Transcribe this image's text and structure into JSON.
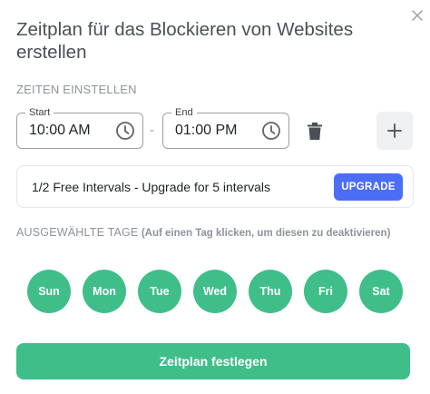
{
  "dialog": {
    "title": "Zeitplan für das Blockieren von Websites erstellen",
    "close_icon": "close-icon"
  },
  "times": {
    "section_label": "ZEITEN EINSTELLEN",
    "start": {
      "label": "Start",
      "value": "10:00 AM",
      "icon": "clock-icon"
    },
    "separator": "-",
    "end": {
      "label": "End",
      "value": "01:00 PM",
      "icon": "clock-icon"
    },
    "delete_icon": "trash-icon",
    "add_icon": "plus-icon"
  },
  "promo": {
    "text": "1/2 Free Intervals - Upgrade for 5 intervals",
    "button_label": "UPGRADE",
    "button_color": "#4c6ef5"
  },
  "days": {
    "section_label": "AUSGEWÄHLTE TAGE",
    "hint": "(Auf einen Tag klicken, um diesen zu deaktivieren)",
    "active_color": "#3fbe8a",
    "items": [
      {
        "label": "Sun"
      },
      {
        "label": "Mon"
      },
      {
        "label": "Tue"
      },
      {
        "label": "Wed"
      },
      {
        "label": "Thu"
      },
      {
        "label": "Fri"
      },
      {
        "label": "Sat"
      }
    ]
  },
  "footer": {
    "submit_label": "Zeitplan festlegen"
  }
}
